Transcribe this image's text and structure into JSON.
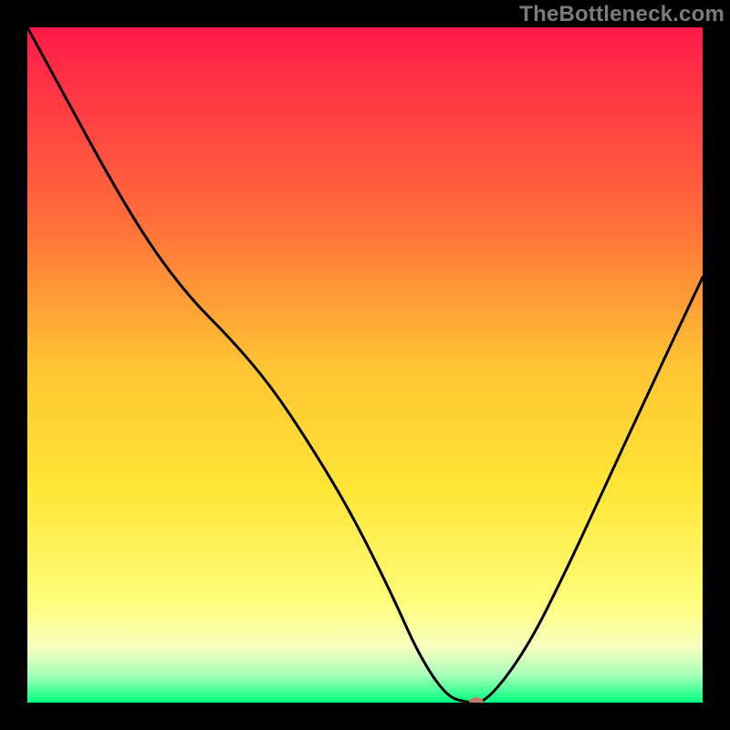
{
  "watermark": "TheBottleneck.com",
  "chart_data": {
    "type": "line",
    "title": "",
    "xlabel": "",
    "ylabel": "",
    "xlim": [
      0,
      100
    ],
    "ylim": [
      0,
      100
    ],
    "grid": false,
    "legend": false,
    "background": {
      "type": "vertical-gradient",
      "stops": [
        {
          "pos": 0,
          "color": "#ff1a49"
        },
        {
          "pos": 28,
          "color": "#ff6b3a"
        },
        {
          "pos": 50,
          "color": "#ffc433"
        },
        {
          "pos": 68,
          "color": "#ffe536"
        },
        {
          "pos": 85,
          "color": "#fffd7a"
        },
        {
          "pos": 92,
          "color": "#f6ffc0"
        },
        {
          "pos": 96,
          "color": "#a4ffb9"
        },
        {
          "pos": 100,
          "color": "#00ff7d"
        }
      ]
    },
    "series": [
      {
        "name": "bottleneck-curve",
        "color": "#000000",
        "x": [
          0,
          6,
          12,
          18,
          24,
          30,
          36,
          42,
          48,
          54,
          58,
          62,
          65,
          68,
          74,
          80,
          86,
          92,
          100
        ],
        "values": [
          100,
          89,
          78,
          68,
          60,
          54,
          47,
          38,
          28,
          16,
          7,
          1,
          0,
          0,
          8,
          20,
          33,
          46,
          63
        ]
      }
    ],
    "marker": {
      "x": 66.5,
      "y": 0,
      "color": "#c77a6c"
    }
  }
}
